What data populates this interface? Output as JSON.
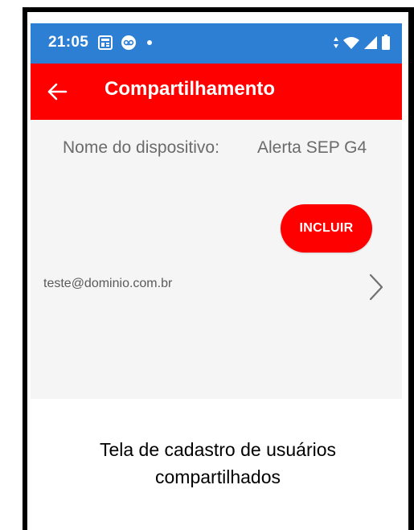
{
  "status_bar": {
    "time": "21:05",
    "left_icons": [
      "news-icon",
      "voicemail-icon",
      "dot-icon"
    ],
    "right_icons": [
      "data-arrows-icon",
      "wifi-icon",
      "signal-icon",
      "battery-icon"
    ],
    "color": "#2d7fd4"
  },
  "app_bar": {
    "title": "Compartilhamento",
    "back_icon": "arrow-left-icon",
    "color": "#ff0000"
  },
  "device": {
    "label": "Nome do dispositivo:",
    "name": "Alerta SEP G4"
  },
  "actions": {
    "include_label": "INCLUIR"
  },
  "users": [
    {
      "email": "teste@dominio.com.br",
      "icon": "chevron-right-icon"
    }
  ],
  "caption": {
    "line1": "Tela de cadastro de usuários",
    "line2": "compartilhados"
  }
}
